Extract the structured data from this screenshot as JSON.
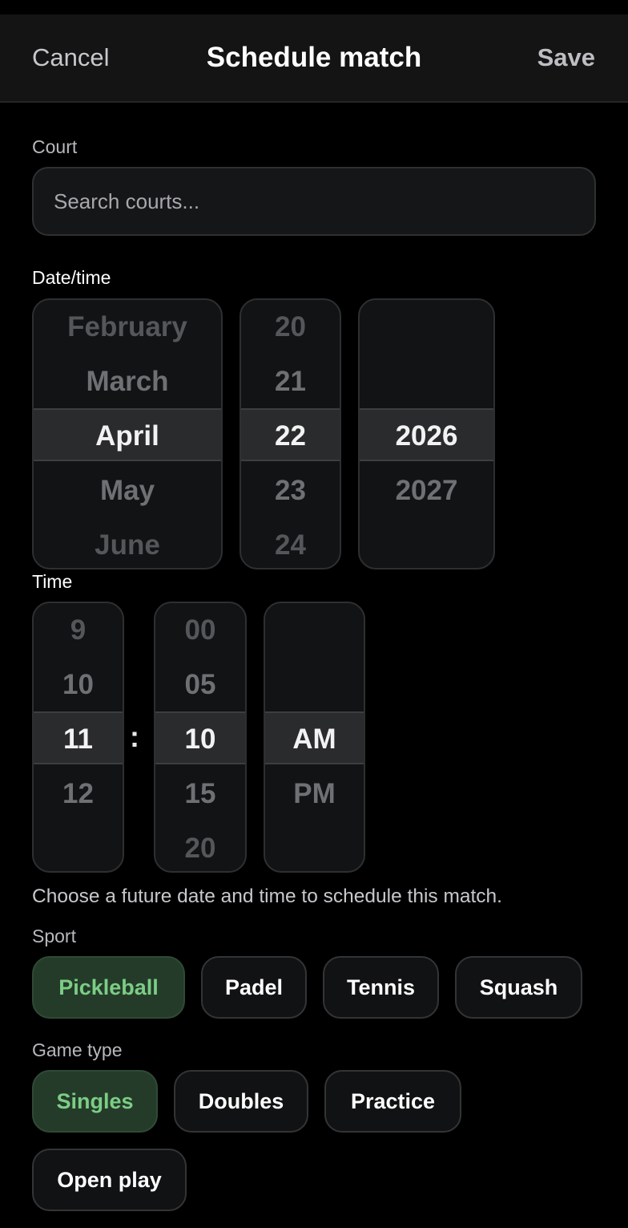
{
  "header": {
    "cancel_label": "Cancel",
    "title": "Schedule match",
    "save_label": "Save"
  },
  "court": {
    "label": "Court",
    "search_placeholder": "Search courts..."
  },
  "datetime": {
    "label": "Date/time",
    "month": {
      "options": [
        "February",
        "March",
        "April",
        "May",
        "June"
      ],
      "selected": "April"
    },
    "day": {
      "options": [
        "20",
        "21",
        "22",
        "23",
        "24"
      ],
      "selected": "22"
    },
    "year": {
      "options": [
        "2026",
        "2027"
      ],
      "selected": "2026"
    }
  },
  "time": {
    "label": "Time",
    "hour": {
      "options": [
        "9",
        "10",
        "11",
        "12"
      ],
      "selected": "11"
    },
    "separator": ":",
    "minute": {
      "options": [
        "00",
        "05",
        "10",
        "15",
        "20"
      ],
      "selected": "10"
    },
    "period": {
      "options": [
        "AM",
        "PM"
      ],
      "selected": "AM"
    }
  },
  "helper_text": "Choose a future date and time to schedule this match.",
  "sport": {
    "label": "Sport",
    "options": [
      "Pickleball",
      "Padel",
      "Tennis",
      "Squash"
    ],
    "selected": "Pickleball"
  },
  "game_type": {
    "label": "Game type",
    "options": [
      "Singles",
      "Doubles",
      "Practice",
      "Open play"
    ],
    "selected": "Singles"
  },
  "colors": {
    "accent_text": "#7ccd85",
    "accent_bg": "#243b2a",
    "background": "#000000",
    "header_bg": "#141414"
  }
}
